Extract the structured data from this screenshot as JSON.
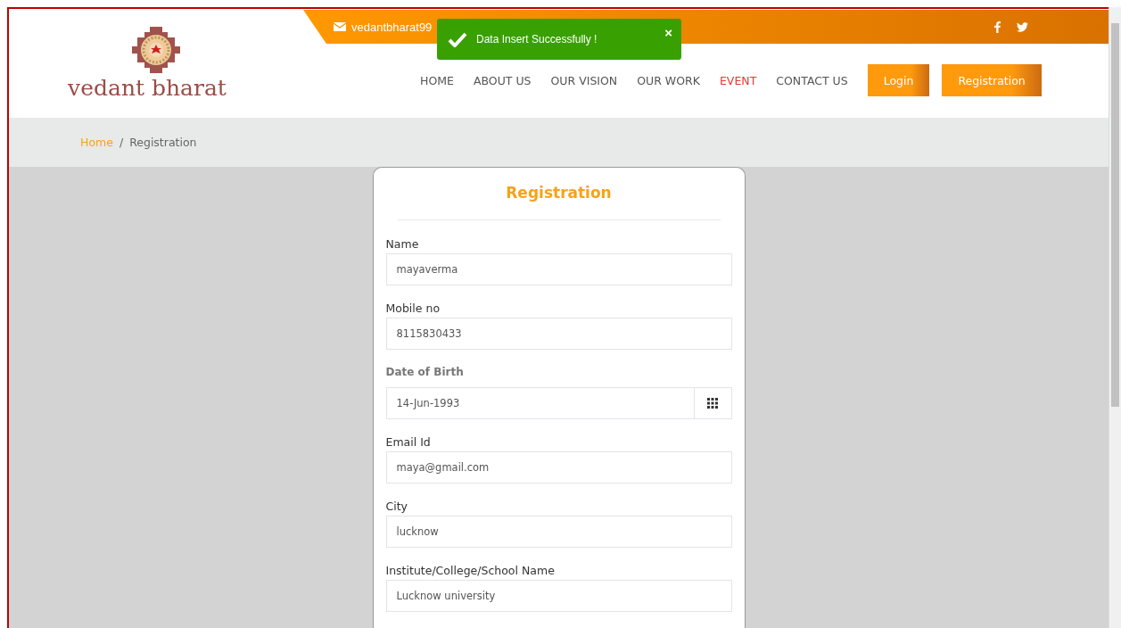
{
  "topbar": {
    "email": "vedantbharat99"
  },
  "logo": {
    "text": "vedant bharat"
  },
  "nav": [
    {
      "label": "HOME",
      "selected": false
    },
    {
      "label": "ABOUT US",
      "selected": false
    },
    {
      "label": "OUR VISION",
      "selected": false
    },
    {
      "label": "OUR WORK",
      "selected": false
    },
    {
      "label": "EVENT",
      "selected": true
    },
    {
      "label": "CONTACT US",
      "selected": false
    }
  ],
  "buttons": [
    "Login",
    "Registration"
  ],
  "breadcrumb": {
    "home": "Home",
    "separator": "/",
    "current": "Registration"
  },
  "toast": {
    "message": "Data Insert Successfully !",
    "close": "×"
  },
  "form": {
    "title": "Registration",
    "fields": [
      {
        "kind": "text",
        "label": "Name",
        "value": "mayaverma"
      },
      {
        "kind": "text",
        "label": "Mobile no",
        "value": "8115830433"
      },
      {
        "kind": "date",
        "label": "Date of Birth",
        "value": "14-Jun-1993"
      },
      {
        "kind": "text",
        "label": "Email Id",
        "value": "maya@gmail.com"
      },
      {
        "kind": "text",
        "label": "City",
        "value": "lucknow"
      },
      {
        "kind": "text",
        "label": "Institute/College/School Name",
        "value": "Lucknow university"
      }
    ]
  }
}
